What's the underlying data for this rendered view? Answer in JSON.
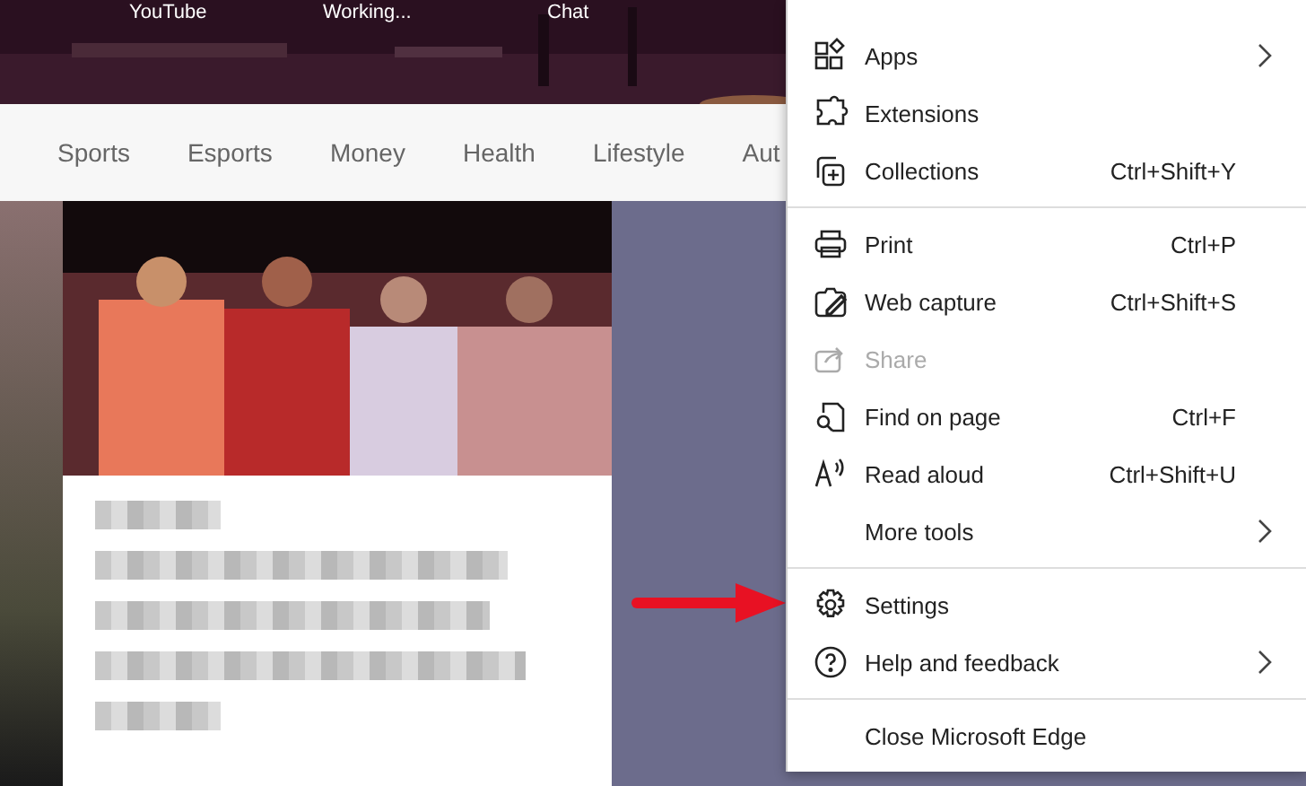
{
  "bookmarks_bar": [
    {
      "label": "YouTube"
    },
    {
      "label": "Working..."
    },
    {
      "label": "Chat"
    }
  ],
  "categories": [
    {
      "label": "Sports"
    },
    {
      "label": "Esports"
    },
    {
      "label": "Money"
    },
    {
      "label": "Health"
    },
    {
      "label": "Lifestyle"
    },
    {
      "label": "Aut"
    }
  ],
  "menu": {
    "groups": [
      [
        {
          "label": "Apps",
          "submenu": true,
          "disabled": false
        },
        {
          "label": "Extensions",
          "submenu": false,
          "disabled": false
        },
        {
          "label": "Collections",
          "shortcut": "Ctrl+Shift+Y",
          "submenu": false,
          "disabled": false
        }
      ],
      [
        {
          "label": "Print",
          "shortcut": "Ctrl+P",
          "submenu": false,
          "disabled": false
        },
        {
          "label": "Web capture",
          "shortcut": "Ctrl+Shift+S",
          "submenu": false,
          "disabled": false
        },
        {
          "label": "Share",
          "submenu": false,
          "disabled": true
        },
        {
          "label": "Find on page",
          "shortcut": "Ctrl+F",
          "submenu": false,
          "disabled": false
        },
        {
          "label": "Read aloud",
          "shortcut": "Ctrl+Shift+U",
          "submenu": false,
          "disabled": false
        },
        {
          "label": "More tools",
          "submenu": true,
          "disabled": false
        }
      ],
      [
        {
          "label": "Settings",
          "submenu": false,
          "disabled": false
        },
        {
          "label": "Help and feedback",
          "submenu": true,
          "disabled": false
        }
      ],
      [
        {
          "label": "Close Microsoft Edge",
          "submenu": false,
          "disabled": false
        }
      ]
    ]
  },
  "annotation": {
    "kind": "arrow",
    "color": "#e81123"
  }
}
